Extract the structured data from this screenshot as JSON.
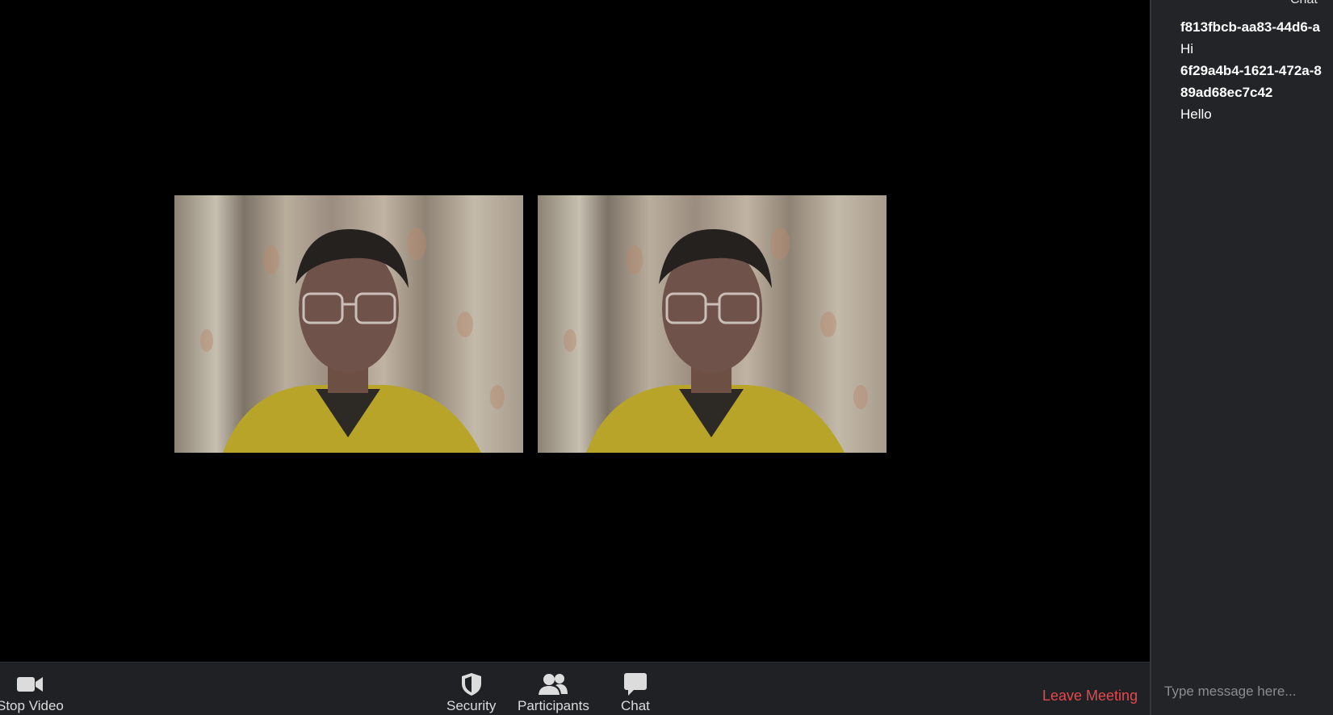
{
  "chat": {
    "title": "Chat",
    "messages": [
      {
        "sender": "f813fbcb-aa83-44d6-a",
        "text": "Hi"
      },
      {
        "sender": "6f29a4b4-1621-472a-8",
        "sender_line2": "89ad68ec7c42",
        "text": "Hello"
      }
    ],
    "input_placeholder": "Type message here..."
  },
  "toolbar": {
    "stop_video_label": "Stop Video",
    "security_label": "Security",
    "participants_label": "Participants",
    "chat_label": "Chat",
    "leave_label": "Leave Meeting",
    "leave_color": "#e5484d"
  },
  "icons": {
    "stop_video": "video-camera-icon",
    "security": "shield-icon",
    "participants": "people-icon",
    "chat": "speech-bubble-icon"
  },
  "colors": {
    "stage_background": "#000000",
    "toolbar_background": "#1f2124",
    "chat_background": "#232427"
  }
}
